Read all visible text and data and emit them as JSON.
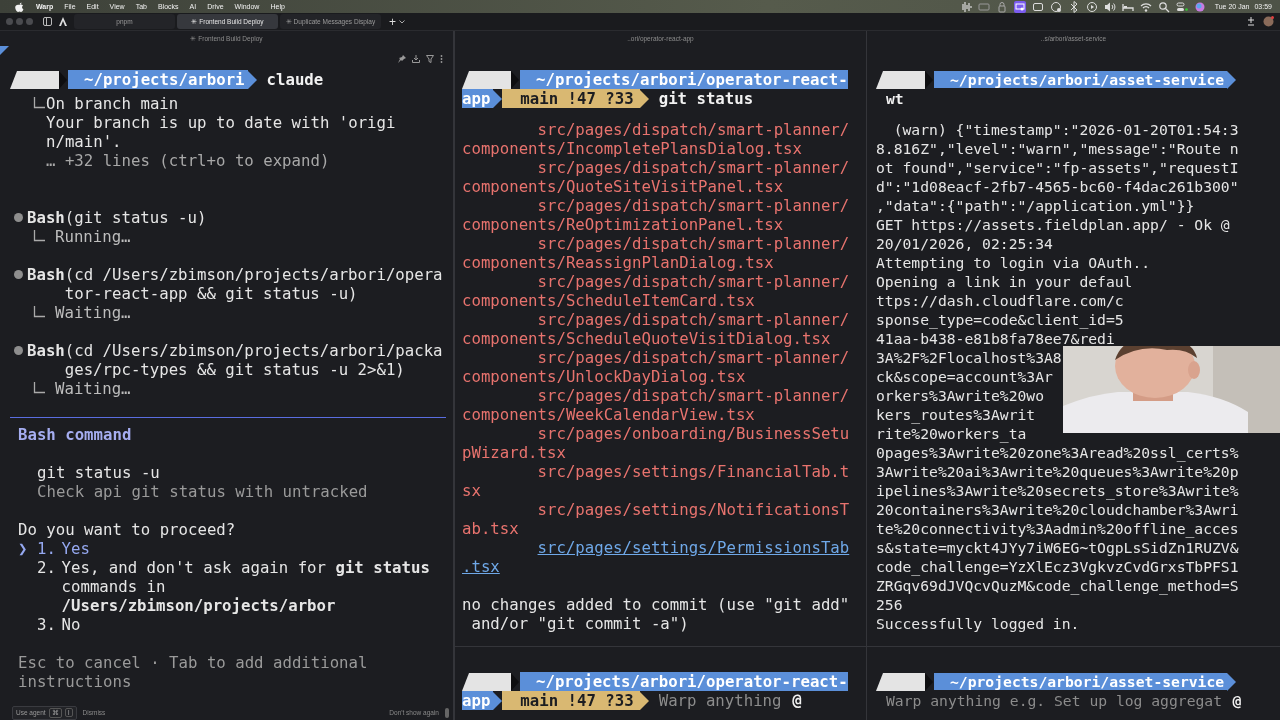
{
  "menubar": {
    "app": "Warp",
    "menus": [
      "File",
      "Edit",
      "View",
      "Tab",
      "Blocks",
      "AI",
      "Drive",
      "Window",
      "Help"
    ],
    "date": "Tue 20 Jan",
    "time": "03:59"
  },
  "tab_bar": {
    "tabs": [
      {
        "label": "pnpm",
        "selected": false
      },
      {
        "label": "✳ Frontend Build Deploy",
        "selected": true
      },
      {
        "label": "✳ Duplicate Messages Display",
        "selected": false
      }
    ],
    "new_tab": "+"
  },
  "left_pane": {
    "title": "✳ Frontend Build Deploy",
    "prompt": {
      "path": "~/projects/arbori",
      "command": "claude"
    },
    "transcript": [
      {
        "kind": "output",
        "lines": [
          {
            "text": "On branch main",
            "dim": false
          },
          {
            "text": "Your branch is up to date with 'origi",
            "dim": false
          },
          {
            "text": "n/main'.",
            "dim": false
          },
          {
            "text": "… +32 lines (ctrl+o to expand)",
            "dim": true
          }
        ]
      },
      {
        "kind": "tool",
        "call": "**Bash**(git status -u)",
        "status": "Running…"
      },
      {
        "kind": "tool",
        "call": "**Bash**(cd /Users/zbimson/projects/arbori/operator-react-app && git status -u)",
        "status": "Waiting…"
      },
      {
        "kind": "tool",
        "call": "**Bash**(cd /Users/zbimson/projects/arbori/packages/rpc-types && git status -u 2>&1)",
        "status": "Waiting…"
      }
    ],
    "dialog": {
      "title": "Bash command",
      "command": "git status -u",
      "description": "Check api git status with untracked",
      "question": "Do you want to proceed?",
      "pointer": "❯",
      "options": [
        {
          "number": "1.",
          "label": "Yes",
          "selected": true
        },
        {
          "number": "2.",
          "label": "Yes, and don't ask again for **git status** commands in **/Users/zbimson/projects/arbor**",
          "selected": false
        },
        {
          "number": "3.",
          "label": "No",
          "selected": false
        }
      ],
      "hint": "Esc to cancel · Tab to add additional instructions"
    },
    "agent_bar": {
      "use_agent": "Use agent",
      "keys": [
        "⌘",
        "I"
      ],
      "dismiss": "Dismiss",
      "dont_show": "Don't show again"
    }
  },
  "middle_pane": {
    "title": "..ori/operator-react-app",
    "prompt": {
      "path": "~/projects/arbori/operator-react-app",
      "git": "main !47 ?33",
      "command": "git status"
    },
    "files": [
      {
        "path": "src/pages/dispatch/smart-planner/components/IncompletePlansDialog.tsx",
        "highlighted": false
      },
      {
        "path": "src/pages/dispatch/smart-planner/components/QuoteSiteVisitPanel.tsx",
        "highlighted": false
      },
      {
        "path": "src/pages/dispatch/smart-planner/components/ReOptimizationPanel.tsx",
        "highlighted": false
      },
      {
        "path": "src/pages/dispatch/smart-planner/components/ReassignPlanDialog.tsx",
        "highlighted": false
      },
      {
        "path": "src/pages/dispatch/smart-planner/components/ScheduleItemCard.tsx",
        "highlighted": false
      },
      {
        "path": "src/pages/dispatch/smart-planner/components/ScheduleQuoteVisitDialog.tsx",
        "highlighted": false
      },
      {
        "path": "src/pages/dispatch/smart-planner/components/UnlockDayDialog.tsx",
        "highlighted": false
      },
      {
        "path": "src/pages/dispatch/smart-planner/components/WeekCalendarView.tsx",
        "highlighted": false
      },
      {
        "path": "src/pages/onboarding/BusinessSetupWizard.tsx",
        "highlighted": false
      },
      {
        "path": "src/pages/settings/FinancialTab.tsx",
        "highlighted": false
      },
      {
        "path": "src/pages/settings/NotificationsTab.tsx",
        "highlighted": false
      },
      {
        "path": "src/pages/settings/PermissionsTab.tsx",
        "highlighted": true
      }
    ],
    "message": "no changes added to commit (use \"git add\" and/or \"git commit -a\")",
    "input": {
      "path": "~/projects/arbori/operator-react-app",
      "git": "main !47 ?33",
      "placeholder": "Warp anything",
      "mention": "@"
    }
  },
  "right_pane": {
    "title": "..s/arbori/asset-service",
    "prompt": {
      "path": "~/projects/arbori/asset-service",
      "command": "wt"
    },
    "log": [
      "  (warn) {\"timestamp\":\"2026-01-20T01:54:3",
      "8.816Z\",\"level\":\"warn\",\"message\":\"Route n",
      "ot found\",\"service\":\"fp-assets\",\"requestI",
      "d\":\"1d08eacf-2fb7-4565-bc60-f4dac261b300\"",
      ",\"data\":{\"path\":\"/application.yml\"}}",
      "GET https://assets.fieldplan.app/ - Ok @",
      "20/01/2026, 02:25:34",
      "Attempting to login via OAuth..",
      "Opening a link in your defaul",
      "ttps://dash.cloudflare.com/c",
      "sponse_type=code&client_id=5",
      "41aa-b438-e81b8fa78ee7&redi",
      "3A%2F%2Flocalhost%3A8",
      "ck&scope=account%3Ar",
      "orkers%3Awrite%20wo",
      "kers_routes%3Awrit",
      "rite%20workers_ta",
      "0pages%3Awrite%20zone%3Aread%20ssl_certs%",
      "3Awrite%20ai%3Awrite%20queues%3Awrite%20p",
      "ipelines%3Awrite%20secrets_store%3Awrite%",
      "20containers%3Awrite%20cloudchamber%3Awri",
      "te%20connectivity%3Aadmin%20offline_acces",
      "s&state=myckt4JYy7iW6EG~tOgpLsSidZn1RUZV&",
      "code_challenge=YzXlEcz3VgkvzCvdGrxsTbPFS1",
      "ZRGqv69dJVQcvQuzM&code_challenge_method=S",
      "256",
      "Successfully logged in."
    ],
    "input": {
      "path": "~/projects/arbori/asset-service",
      "placeholder": "Warp anything e.g. Set up log aggregat",
      "mention": "@"
    }
  }
}
